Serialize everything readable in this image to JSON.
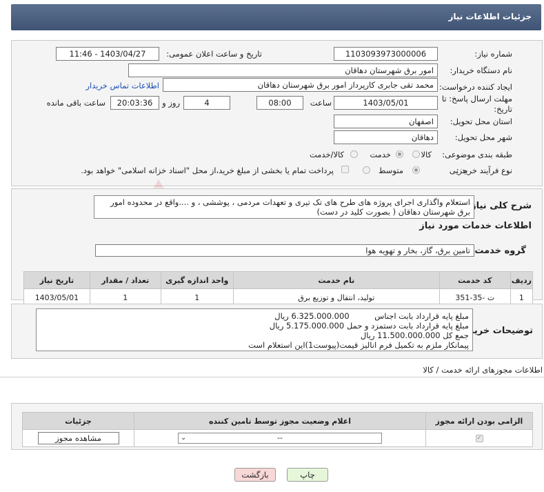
{
  "header": {
    "title": "جزئیات اطلاعات نیاز"
  },
  "fields": {
    "need_number_label": "شماره نیاز:",
    "need_number": "1103093973000006",
    "announce_label": "تاریخ و ساعت اعلان عمومی:",
    "announce_value": "1403/04/27 - 11:46",
    "buyer_org_label": "نام دستگاه خریدار:",
    "buyer_org": "امور برق شهرستان دهاقان",
    "creator_label": "ایجاد کننده درخواست:",
    "creator": "محمد تقی جابری کارپرداز امور برق شهرستان دهاقان",
    "buyer_contact_link": "اطلاعات تماس خریدار",
    "deadline_label_1": "مهلت ارسال پاسخ: تا",
    "deadline_label_2": "تاریخ:",
    "deadline_date": "1403/05/01",
    "time_label": "ساعت",
    "deadline_time": "08:00",
    "days_value": "4",
    "days_label": "روز و",
    "remaining_time": "20:03:36",
    "remaining_label": "ساعت باقی مانده",
    "province_label": "استان محل تحویل:",
    "province": "اصفهان",
    "city_label": "شهر محل تحویل:",
    "city": "دهاقان",
    "category_label": "طبقه بندی موضوعی:",
    "category_options": [
      "کالا",
      "خدمت",
      "کالا/خدمت"
    ],
    "category_selected": "خدمت",
    "process_label": "نوع فرآیند خرید :",
    "process_options": [
      "جزیی",
      "متوسط"
    ],
    "process_selected": "جزیی",
    "treasury_note": "پرداخت تمام یا بخشی از مبلغ خرید،از محل \"اسناد خزانه اسلامی\" خواهد بود."
  },
  "summary": {
    "label": "شرح کلی نیاز:",
    "text": "استعلام واگذاری اجرای پروژه های طرح های تک تیری و تعهدات مردمی ، پوششی ، و ....واقع در محدوده امور برق شهرستان دهاقان ( بصورت کلید در دست)"
  },
  "services": {
    "section_title": "اطلاعات خدمات مورد نیاز",
    "group_label": "گروه خدمت:",
    "group_value": "تامین برق، گاز، بخار و تهویه هوا",
    "columns": [
      "ردیف",
      "کد خدمت",
      "نام خدمت",
      "واحد اندازه گیری",
      "تعداد / مقدار",
      "تاریخ نیاز"
    ],
    "rows": [
      [
        "1",
        "ت -35-351",
        "تولید، انتقال و توزیع برق",
        "1",
        "1",
        "1403/05/01"
      ]
    ]
  },
  "buyer_notes": {
    "label": "توضیحات خریدار:",
    "lines": [
      "مبلغ پایه قرارداد بابت اجناس          6.325.000.000 ریال",
      "مبلغ پایه قرارداد بابت دستمزد و حمل 5.175.000.000 ریال",
      "جمع کل 11.500.000.000 ریال",
      "پیمانکار ملزم به تکمیل فرم انالیز قیمت(پیوست1)این استعلام است"
    ]
  },
  "permits": {
    "section_title": "اطلاعات مجوزهای ارائه خدمت / کالا",
    "columns": [
      "الزامی بودن ارائه مجوز",
      "اعلام وضعیت مجوز توسط تامین کننده",
      "جزئیات"
    ],
    "select_value": "--",
    "view_button": "مشاهده مجوز"
  },
  "buttons": {
    "print": "چاپ",
    "back": "بازگشت"
  },
  "watermark": {
    "text": "AriaTender.neT"
  },
  "colors": {
    "header_bg": "#4a5d7e",
    "link": "#1a4fb3",
    "back_btn_bg": "#f8d7d7",
    "print_btn_bg": "#e6f7d9"
  }
}
